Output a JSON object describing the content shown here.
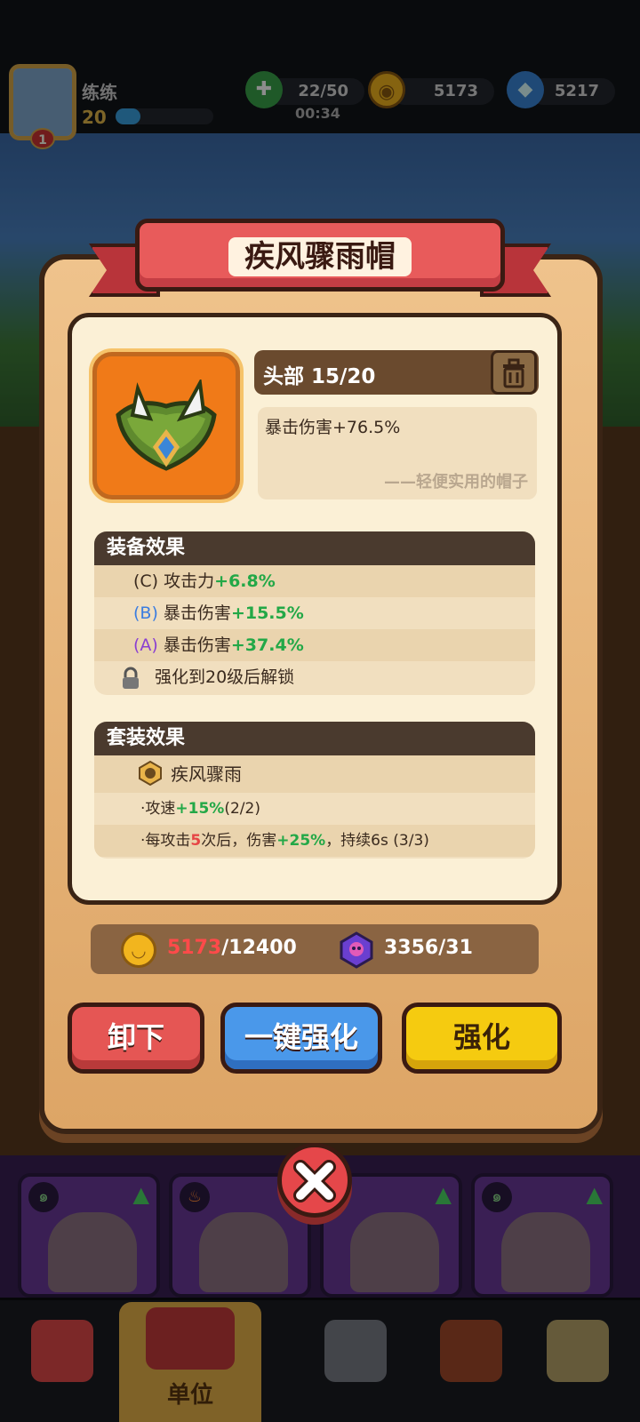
{
  "hud": {
    "player_name": "练练",
    "player_level": "20",
    "rank_badge": "1",
    "stamina": "22/50",
    "stamina_timer": "00:34",
    "coins": "5173",
    "gems": "5217",
    "xp_fraction": 0.25
  },
  "popup": {
    "title": "疾风骤雨帽",
    "slot_label": "头部 15/20",
    "main_stat": "暴击伤害+76.5%",
    "flavor_text": "——轻便实用的帽子",
    "equip_effects": {
      "header": "装备效果",
      "rows": [
        {
          "grade": "(C)",
          "stat": "攻击力",
          "value": "+6.8%"
        },
        {
          "grade": "(B)",
          "stat": "暴击伤害",
          "value": "+15.5%"
        },
        {
          "grade": "(A)",
          "stat": "暴击伤害",
          "value": "+37.4%"
        }
      ],
      "locked_text": "强化到20级后解锁"
    },
    "set_effects": {
      "header": "套装效果",
      "set_name": "疾风骤雨",
      "line1_prefix": "·攻速",
      "line1_value": "+15%",
      "line1_suffix": "(2/2)",
      "line2_prefix": "·每攻击",
      "line2_count": "5",
      "line2_mid": "次后，伤害",
      "line2_value": "+25%",
      "line2_suffix": "，持续6s (3/3)"
    },
    "cost": {
      "coins_have": "5173",
      "coins_need": "/12400",
      "gems": "3356/31"
    },
    "buttons": {
      "unequip": "卸下",
      "one_key_upgrade": "一键强化",
      "upgrade": "强化"
    }
  },
  "nav": {
    "active_label": "单位"
  },
  "colors": {
    "accent_green": "#23a847",
    "accent_red": "#e64545",
    "popup_bg": "#e8b878"
  }
}
